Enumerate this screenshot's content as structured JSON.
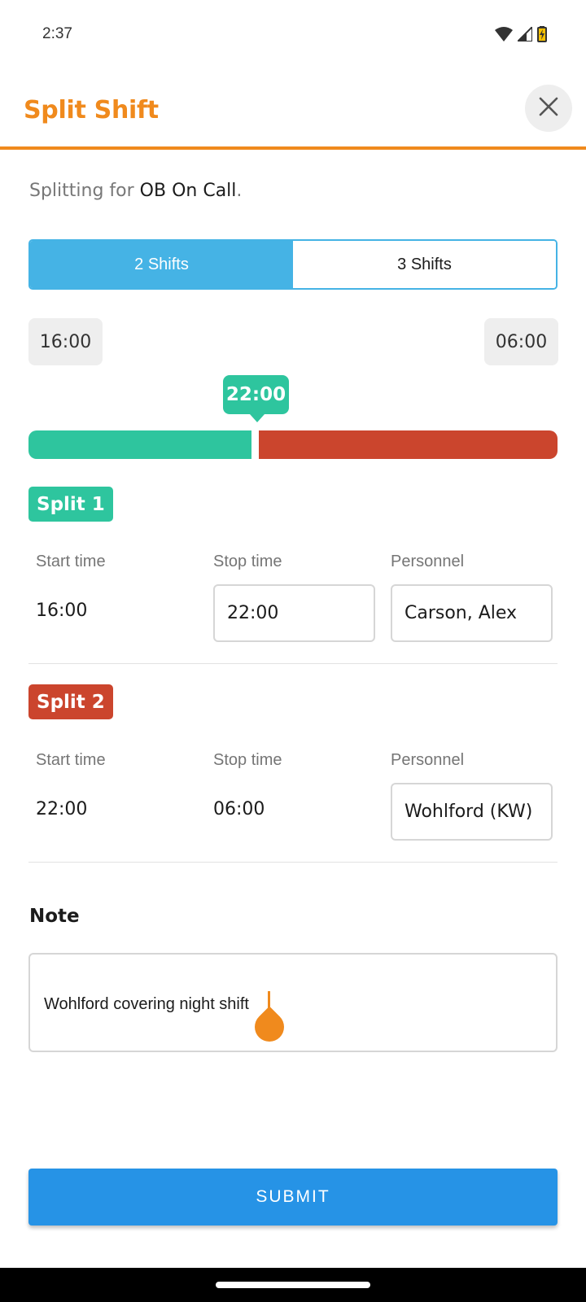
{
  "status_bar": {
    "time": "2:37",
    "icons": [
      "wifi-icon",
      "cell-signal-icon",
      "battery-charging-icon"
    ]
  },
  "header": {
    "title": "Split Shift",
    "close_icon": "close-icon",
    "accent_color": "#f08a1d"
  },
  "context": {
    "prefix": "Splitting for",
    "unit_name": "OB On Call",
    "suffix": "."
  },
  "shift_count_toggle": {
    "options": [
      "2 Shifts",
      "3 Shifts"
    ],
    "selected": "2 Shifts",
    "active_color": "#45b3e5"
  },
  "timeline": {
    "start": "16:00",
    "end": "06:00",
    "split_point": "22:00",
    "split_fraction": 0.43,
    "colors": {
      "split1": "#2ec59e",
      "split2": "#cb452d"
    }
  },
  "columns": {
    "start": "Start time",
    "stop": "Stop time",
    "personnel": "Personnel"
  },
  "splits": [
    {
      "label": "Split 1",
      "start_time": "16:00",
      "stop_time": "22:00",
      "personnel": "Carson, Alex"
    },
    {
      "label": "Split 2",
      "start_time": "22:00",
      "stop_time": "06:00",
      "personnel": "Wohlford (KW)"
    }
  ],
  "note": {
    "label": "Note",
    "value": "Wohlford covering night shift"
  },
  "submit": {
    "label": "SUBMIT",
    "color": "#2693e6"
  }
}
